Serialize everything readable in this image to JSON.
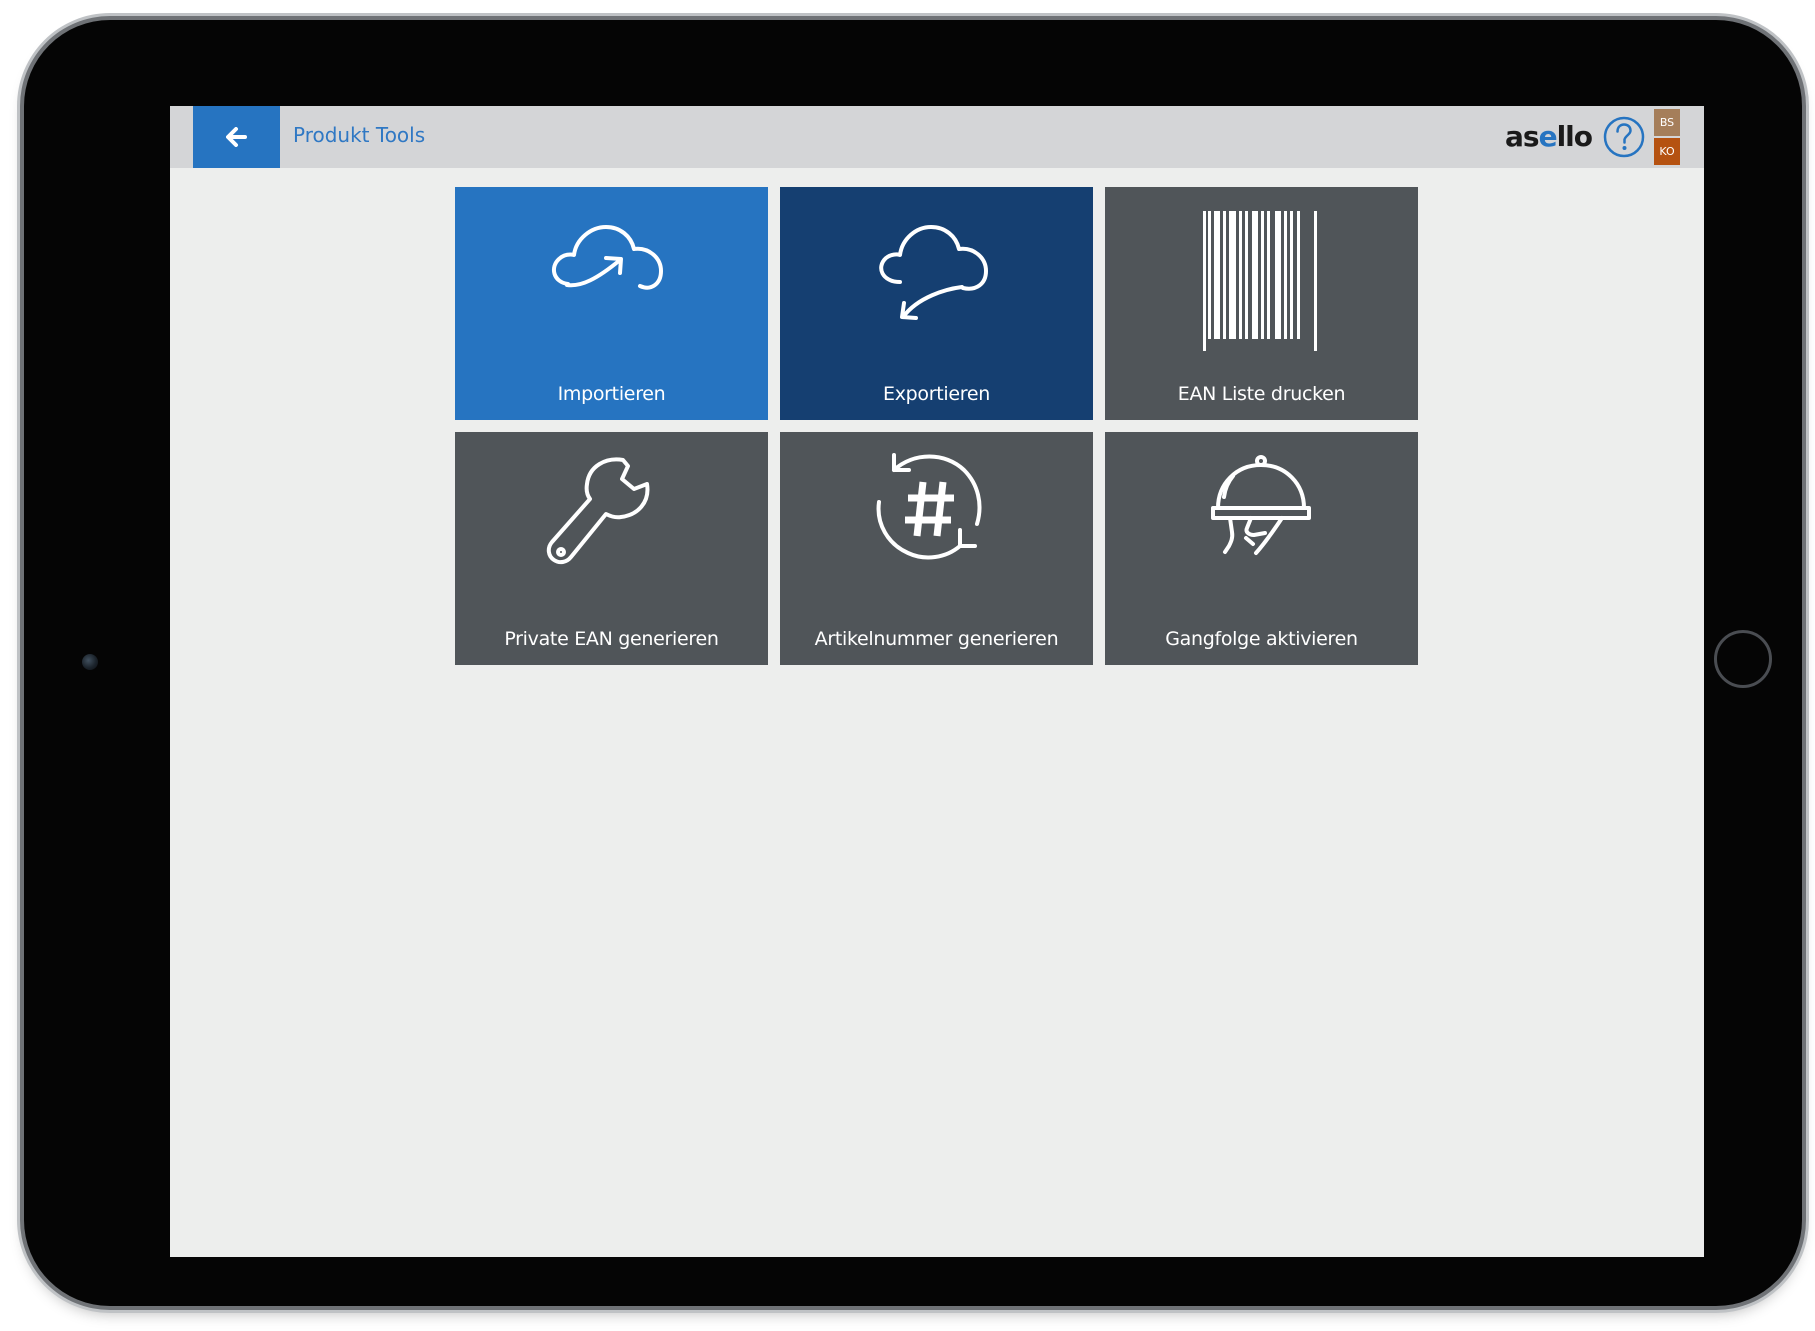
{
  "header": {
    "back_icon": "arrow-left-icon",
    "title": "Produkt Tools",
    "brand": {
      "part1": "as",
      "accent": "e",
      "part2": "llo"
    },
    "help_icon": "question-mark-circle-icon",
    "user_badge": {
      "top": "BS",
      "bottom": "KO"
    }
  },
  "tiles": [
    {
      "label": "Importieren",
      "icon": "cloud-upload-icon",
      "color": "#2674c1"
    },
    {
      "label": "Exportieren",
      "icon": "cloud-download-icon",
      "color": "#153f71"
    },
    {
      "label": "EAN Liste drucken",
      "icon": "barcode-icon",
      "color": "#505559"
    },
    {
      "label": "Private EAN generieren",
      "icon": "wrench-icon",
      "color": "#505559"
    },
    {
      "label": "Artikelnummer generieren",
      "icon": "refresh-hash-icon",
      "color": "#505559"
    },
    {
      "label": "Gangfolge aktivieren",
      "icon": "cloche-serving-icon",
      "color": "#505559"
    }
  ],
  "colors": {
    "accent": "#2674c1",
    "topbar": "#d4d5d7",
    "background": "#edeeed",
    "dark_tile": "#505559",
    "badge_top": "#a57e5a",
    "badge_bottom": "#b55211"
  }
}
